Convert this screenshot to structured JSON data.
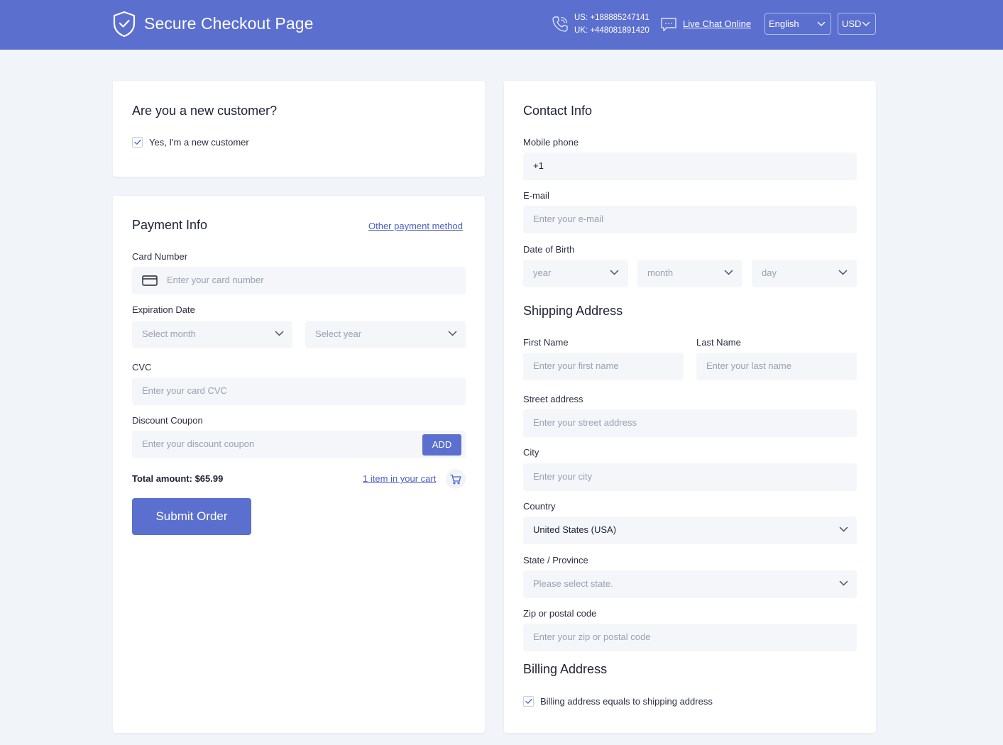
{
  "header": {
    "title": "Secure Checkout Page",
    "phone_us": "US: +188885247141",
    "phone_uk": "UK: +448081891420",
    "chat_label": "Live Chat Online",
    "language": "English",
    "currency": "USD"
  },
  "customer": {
    "title": "Are you a new customer?",
    "new_customer_label": "Yes, I'm a new customer",
    "new_customer_checked": true
  },
  "payment": {
    "title": "Payment Info",
    "other_method_link": "Other payment method",
    "card_number_label": "Card Number",
    "card_number_placeholder": "Enter your card number",
    "expiration_label": "Expiration Date",
    "month_placeholder": "Select month",
    "year_placeholder": "Select year",
    "cvc_label": "CVC",
    "cvc_placeholder": "Enter your card CVC",
    "coupon_label": "Discount Coupon",
    "coupon_placeholder": "Enter your discount coupon",
    "add_button": "ADD",
    "total_text": "Total amount: $65.99",
    "cart_link": "1 item in your cart",
    "submit_button": "Submit Order"
  },
  "contact": {
    "title": "Contact Info",
    "mobile_label": "Mobile phone",
    "mobile_value": "+1",
    "email_label": "E-mail",
    "email_placeholder": "Enter your e-mail",
    "dob_label": "Date of Birth",
    "dob_year": "year",
    "dob_month": "month",
    "dob_day": "day"
  },
  "shipping": {
    "title": "Shipping Address",
    "first_name_label": "First Name",
    "first_name_placeholder": "Enter your first name",
    "last_name_label": "Last Name",
    "last_name_placeholder": "Enter your last name",
    "street_label": "Street address",
    "street_placeholder": "Enter your street address",
    "city_label": "City",
    "city_placeholder": "Enter your city",
    "country_label": "Country",
    "country_value": "United States (USA)",
    "state_label": "State / Province",
    "state_placeholder": "Please select state.",
    "zip_label": "Zip or postal code",
    "zip_placeholder": "Enter your zip or postal code"
  },
  "billing": {
    "title": "Billing Address",
    "same_as_shipping_label": "Billing address equals to shipping address",
    "same_as_shipping_checked": true
  },
  "colors": {
    "header_bg": "#5b6fcf",
    "accent": "#5b6fcf",
    "page_bg": "#f1f4f9",
    "field_bg": "#f4f6fa"
  }
}
